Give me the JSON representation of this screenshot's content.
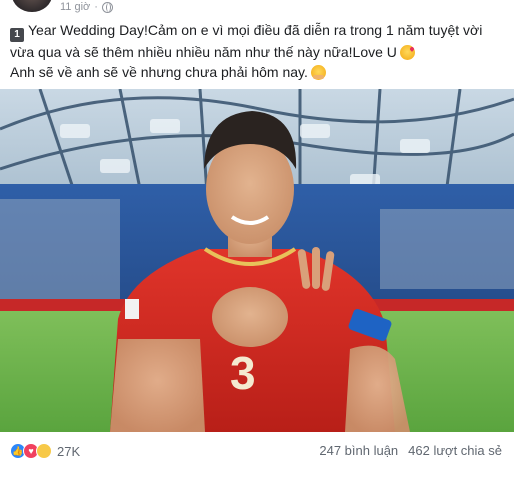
{
  "header": {
    "timestamp": "11 giờ",
    "privacy_icon": "globe-icon"
  },
  "post": {
    "line1_badge": "1",
    "line1": "Year Wedding Day!Cảm on e vì mọi điều đã diễn ra trong 1 năm tuyệt vời vừa qua và sẽ thêm nhiều nhiều năm như thế này nữa!Love U",
    "line2": "Anh sẽ về anh sẽ về nhưng chưa phải hôm nay.",
    "emoji1": "kiss-emoji",
    "emoji2": "hug-emoji"
  },
  "photo": {
    "jersey_number": "3"
  },
  "footer": {
    "reaction_icons": [
      "like-icon",
      "love-icon",
      "haha-icon"
    ],
    "reaction_count": "27K",
    "comments": "247 bình luận",
    "shares": "462 lượt chia sẻ"
  },
  "colors": {
    "like": "#2d87f9",
    "love": "#f1415f",
    "haha": "#f7c948",
    "jersey": "#d9261c"
  }
}
